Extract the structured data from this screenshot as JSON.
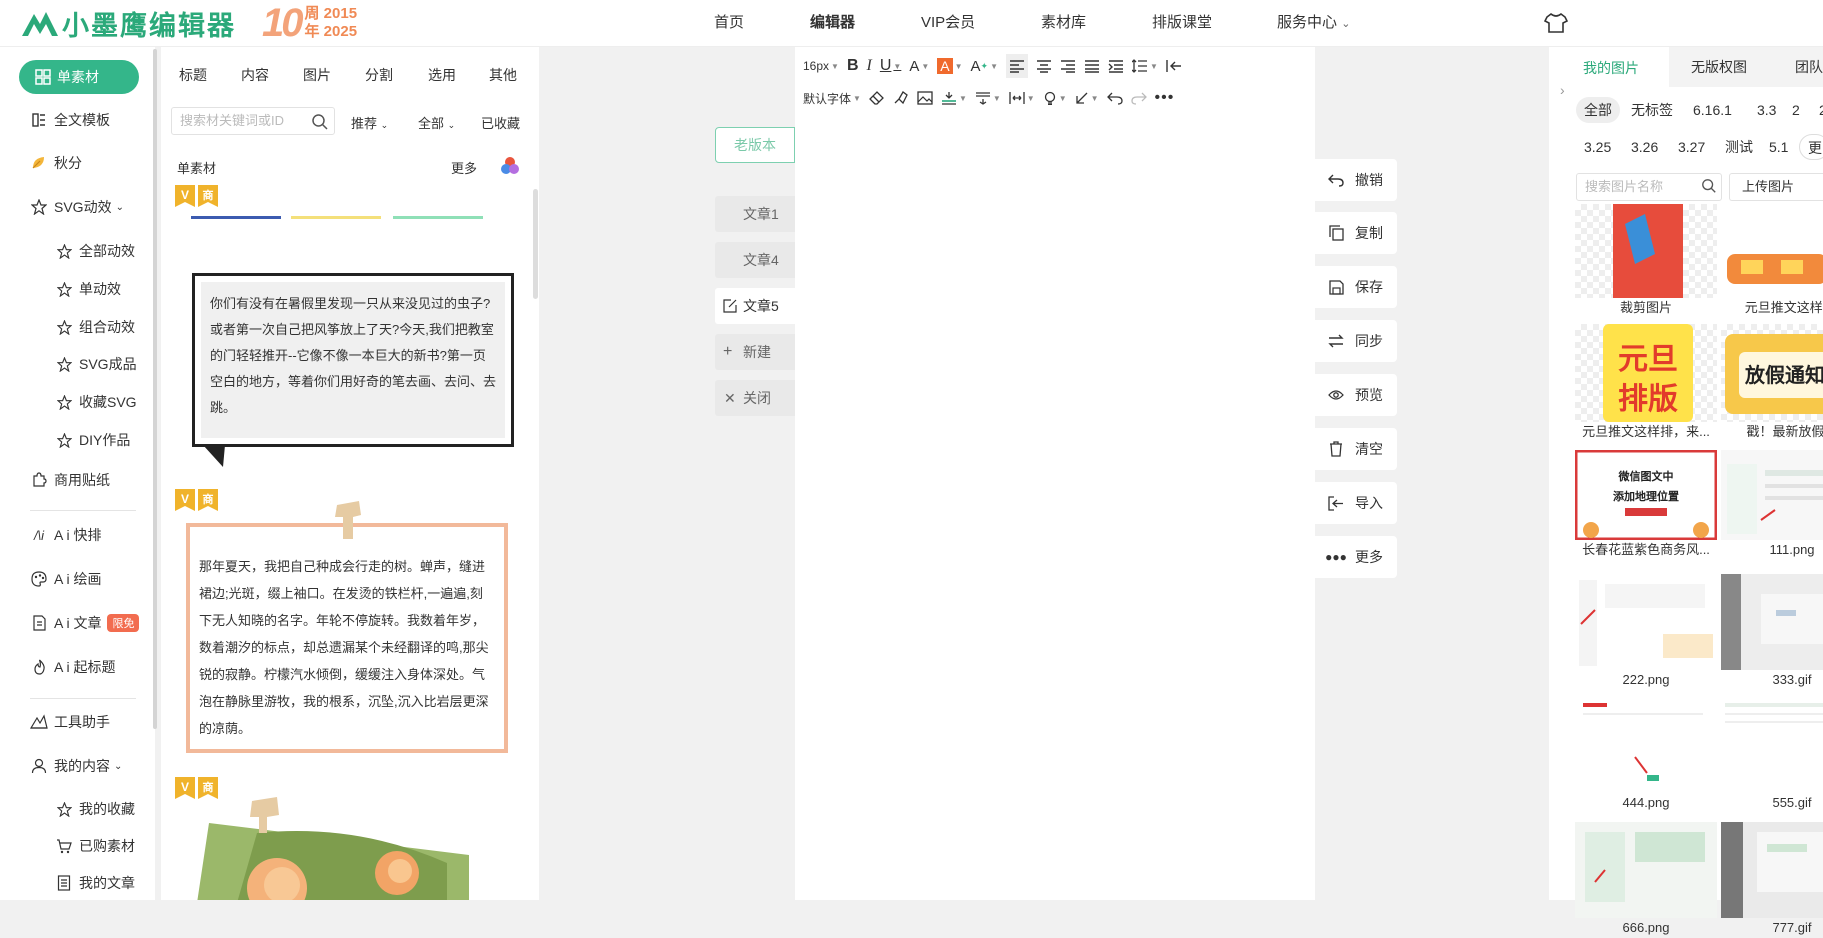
{
  "header": {
    "brand": "小墨鹰编辑器",
    "anniversary": {
      "number": "10",
      "line1": "周 2015",
      "line2": "年 2025"
    },
    "nav": [
      "首页",
      "编辑器",
      "VIP会员",
      "素材库",
      "排版课堂",
      "服务中心"
    ],
    "service_caret": "⌄"
  },
  "sidebar": {
    "single_material": "单素材",
    "full_template": "全文模板",
    "autumn": "秋分",
    "svg_anim": "SVG动效",
    "svg_sub": [
      "全部动效",
      "单动效",
      "组合动效",
      "SVG成品",
      "收藏SVG",
      "DIY作品"
    ],
    "commercial_sticker": "商用贴纸",
    "ai_layout": "A i 快排",
    "ai_draw": "A i 绘画",
    "ai_article": "A i 文章",
    "ai_article_badge": "限免",
    "ai_title": "A i 起标题",
    "tool_helper": "工具助手",
    "my_content": "我的内容",
    "my_sub": [
      "我的收藏",
      "已购素材",
      "我的文章"
    ]
  },
  "materials": {
    "tabs": [
      "标题",
      "内容",
      "图片",
      "分割",
      "选用",
      "其他"
    ],
    "search_placeholder": "搜索材关键词或ID",
    "filter_recommend": "推荐",
    "filter_all": "全部",
    "filter_collected": "已收藏",
    "section_label": "单素材",
    "more": "更多",
    "tag_v": "V",
    "tag_shang": "商",
    "card1_text": "你们有没有在暑假里发现一只从来没见过的虫子?或者第一次自己把风筝放上了天?今天,我们把教室的门轻轻推开--它像不像一本巨大的新书?第一页空白的地方，等着你们用好奇的笔去画、去问、去跳。",
    "card2_text": "那年夏天，我把自己种成会行走的树。蝉声，缝进裙边;光斑，缀上袖口。在发烫的铁栏杆,一遍遍,刻下无人知晓的名字。年轮不停旋转。我数着年岁，数着潮汐的标点，却总遗漏某个未经翻译的鸣,那尖锐的寂静。柠檬汽水倾倒，缓缓注入身体深处。气泡在静脉里游牧，我的根系，沉坠,沉入比岩层更深的凉荫。"
  },
  "editor": {
    "old_version": "老版本",
    "article_tabs": [
      "文章1",
      "文章4",
      "文章5"
    ],
    "new": "新建",
    "close": "关闭",
    "font_size": "16px",
    "default_font": "默认字体"
  },
  "actions": [
    "撤销",
    "复制",
    "保存",
    "同步",
    "预览",
    "清空",
    "导入",
    "更多"
  ],
  "images": {
    "tabs": [
      "我的图片",
      "无版权图",
      "团队"
    ],
    "chips_row1": [
      "全部",
      "无标签",
      "6.16.1",
      "3.3",
      "2",
      "2"
    ],
    "chips_row2": [
      "3.25",
      "3.26",
      "3.27",
      "测试",
      "5.1",
      "更"
    ],
    "search_placeholder": "搜索图片名称",
    "upload": "上传图片",
    "captions": [
      "裁剪图片",
      "元旦推文这样排,",
      "元旦推文这样排，来...",
      "戳！最新放假通",
      "长春花蓝紫色商务风...",
      "111.png",
      "222.png",
      "333.gif",
      "444.png",
      "555.gif",
      "666.png",
      "777.gif"
    ],
    "thumb_text": {
      "yuandan_1": "元旦",
      "yuandan_2": "排版",
      "fangjia": "放假通知",
      "map_title": "微信图文中",
      "map_sub": "添加地理位置"
    }
  },
  "colors": {
    "accent": "#34b68a",
    "brand": "#2ba97a",
    "anniv": "#f08a55",
    "badge": "#f26c4f",
    "orange_border": "#f2b99a"
  }
}
